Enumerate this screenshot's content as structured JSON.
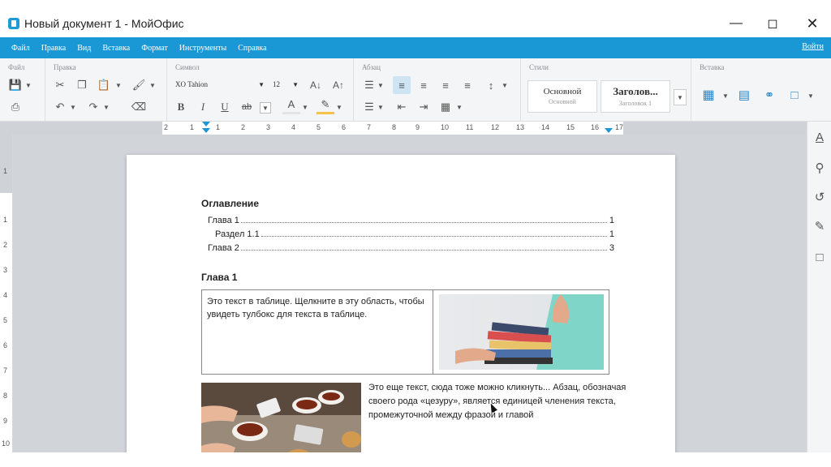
{
  "window": {
    "title": "Новый документ 1 - МойОфис"
  },
  "menu": {
    "items": [
      "Файл",
      "Правка",
      "Вид",
      "Вставка",
      "Формат",
      "Инструменты",
      "Справка"
    ],
    "login": "Войти"
  },
  "toolbar": {
    "groups": [
      "Файл",
      "Правка",
      "Символ",
      "Абзац",
      "Стили",
      "Вставка"
    ],
    "font": {
      "name": "XO Tahion",
      "size": "12"
    },
    "styles": [
      {
        "name": "Основной",
        "sub": "Основной"
      },
      {
        "name": "Заголов...",
        "sub": "Заголовок 1"
      }
    ],
    "glyphs": {
      "bold": "B",
      "italic": "I",
      "underline": "U",
      "strike": "ab",
      "font_color": "A"
    }
  },
  "ruler": {
    "horizontal": [
      "2",
      "1",
      "1",
      "2",
      "3",
      "4",
      "5",
      "6",
      "7",
      "8",
      "9",
      "10",
      "11",
      "12",
      "13",
      "14",
      "15",
      "16",
      "17"
    ],
    "vertical": [
      "1",
      "1",
      "2",
      "3",
      "4",
      "5",
      "6",
      "7",
      "8",
      "9",
      "10"
    ]
  },
  "document": {
    "toc_title": "Оглавление",
    "toc": [
      {
        "label": "Глава 1",
        "page": "1"
      },
      {
        "label": "Раздел 1.1",
        "page": "1"
      },
      {
        "label": "Глава 2",
        "page": "3"
      }
    ],
    "chapter1": "Глава 1",
    "table_text": "Это текст в таблице. Щелкните в эту область, чтобы увидеть тулбокс для текста в таблице.",
    "paragraph": "Это еще текст, сюда тоже можно кликнуть... Абзац, обозначая своего рода «цезуру», является единицей членения текста, промежуточной между фразой и главой"
  },
  "colors": {
    "accent": "#1a97d5",
    "active": "#cfe4f3"
  }
}
